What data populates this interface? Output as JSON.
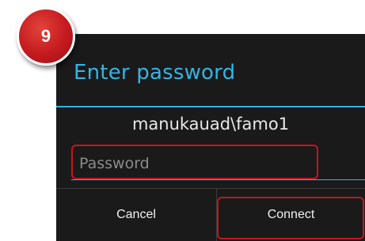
{
  "step": {
    "number": "9"
  },
  "dialog": {
    "title": "Enter password",
    "username": "manukauad\\famo1",
    "password_placeholder": "Password",
    "password_value": "",
    "cancel_label": "Cancel",
    "connect_label": "Connect"
  },
  "colors": {
    "accent": "#33b5e5",
    "highlight": "#c4161c",
    "dialog_bg": "#1a1a1a"
  }
}
